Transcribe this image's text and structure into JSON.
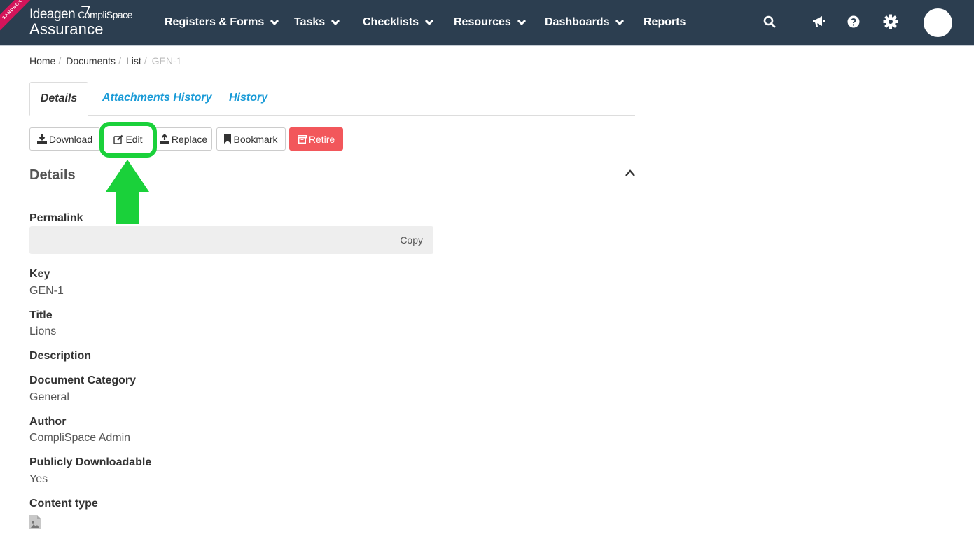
{
  "brand": {
    "sandbox": "SANDBOX",
    "logo_line1": "Ideagen",
    "logo_line1_small": "CompliSpace",
    "logo_line2": "Assurance"
  },
  "nav": {
    "items": [
      {
        "label": "Registers & Forms",
        "has_dropdown": true
      },
      {
        "label": "Tasks",
        "has_dropdown": true
      },
      {
        "label": "Checklists",
        "has_dropdown": true
      },
      {
        "label": "Resources",
        "has_dropdown": true
      },
      {
        "label": "Dashboards",
        "has_dropdown": true
      },
      {
        "label": "Reports",
        "has_dropdown": false
      }
    ],
    "icons": [
      "search-icon",
      "megaphone-icon",
      "help-icon",
      "settings-icon"
    ]
  },
  "breadcrumb": {
    "items": [
      "Home",
      "Documents",
      "List"
    ],
    "current": "GEN-1"
  },
  "tabs": [
    "Details",
    "Attachments History",
    "History"
  ],
  "actions": {
    "download": "Download",
    "edit": "Edit",
    "replace": "Replace",
    "bookmark": "Bookmark",
    "retire": "Retire"
  },
  "annotation": {
    "color": "#1ad13a",
    "target": "Edit"
  },
  "details": {
    "section_title": "Details",
    "permalink": {
      "label": "Permalink",
      "value": "",
      "copy_label": "Copy"
    },
    "fields": [
      {
        "label": "Key",
        "value": "GEN-1"
      },
      {
        "label": "Title",
        "value": "Lions"
      },
      {
        "label": "Description",
        "value": ""
      },
      {
        "label": "Document Category",
        "value": "General"
      },
      {
        "label": "Author",
        "value": "CompliSpace Admin"
      },
      {
        "label": "Publicly Downloadable",
        "value": "Yes"
      }
    ],
    "content_type": {
      "label": "Content type",
      "icon": "image-file-icon"
    }
  },
  "colors": {
    "header_bg": "#2c3e50",
    "link": "#1a9bd7",
    "danger": "#f2575b",
    "sandbox_ribbon": "#d4145a"
  }
}
